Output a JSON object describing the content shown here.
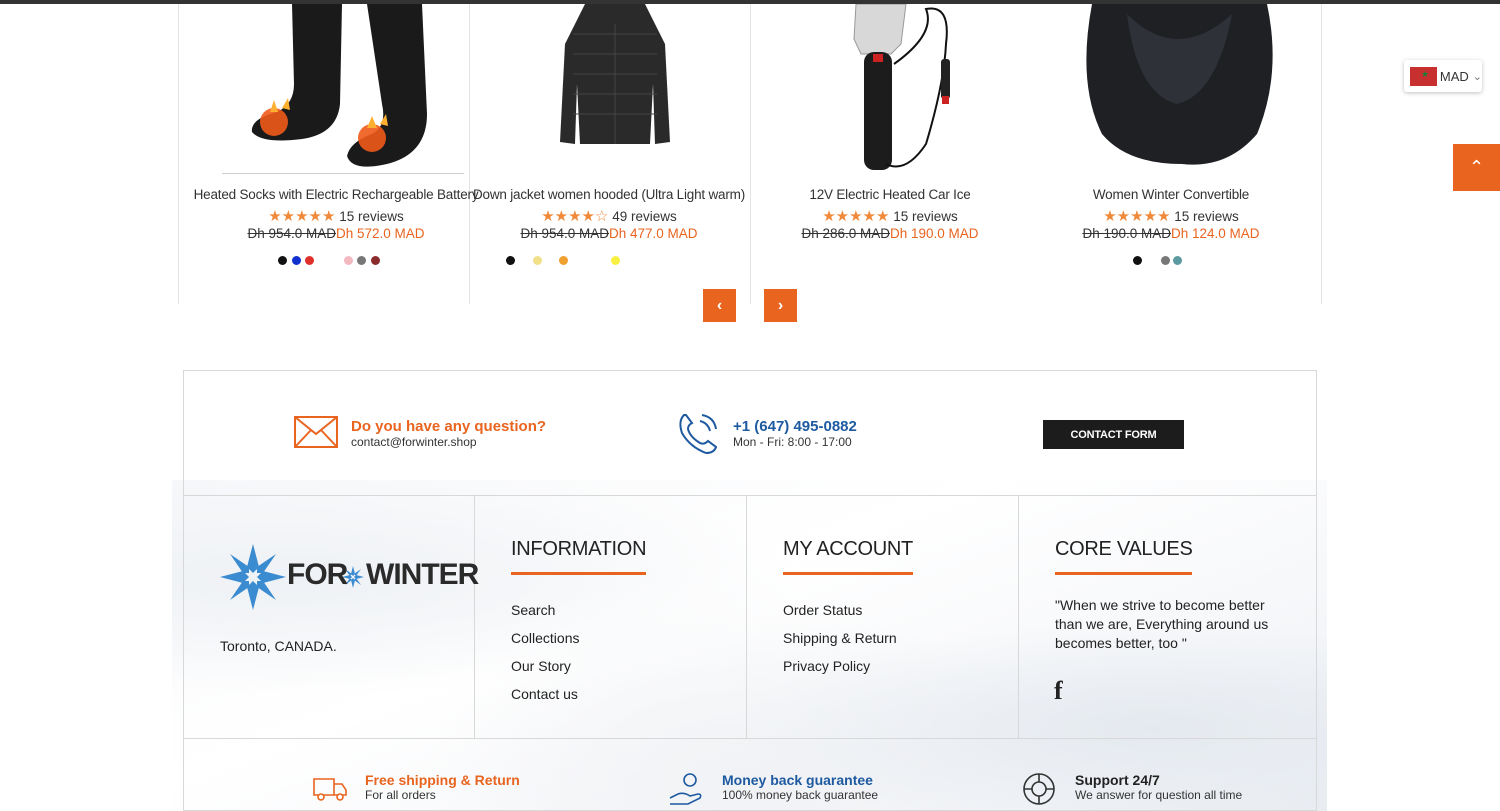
{
  "products": [
    {
      "title": "Heated Socks with Electric Rechargeable Battery",
      "stars": "★★★★★",
      "reviews": "15 reviews",
      "old_price": "Dh 954.0 MAD",
      "new_price": "Dh 572.0 MAD",
      "swatches": [
        "#111111",
        "#1030d0",
        "#e0302a",
        "#f4b8c0",
        "#777777",
        "#8a2c2c"
      ],
      "image": "heated-socks"
    },
    {
      "title": "Down jacket women hooded (Ultra Light warm)",
      "stars": "★★★★☆",
      "reviews": "49 reviews",
      "old_price": "Dh 954.0 MAD",
      "new_price": "Dh 477.0 MAD",
      "swatches": [
        "#111111",
        "#f0e08a",
        "#f0a030",
        "#f8f040"
      ],
      "image": "down-jacket"
    },
    {
      "title": "12V Electric Heated Car Ice",
      "stars": "★★★★★",
      "reviews": "15 reviews",
      "old_price": "Dh 286.0 MAD",
      "new_price": "Dh 190.0 MAD",
      "swatches": [],
      "image": "car-ice-scraper"
    },
    {
      "title": "Women Winter Convertible",
      "stars": "★★★★★",
      "reviews": "15 reviews",
      "old_price": "Dh 190.0 MAD",
      "new_price": "Dh 124.0 MAD",
      "swatches": [
        "#111111",
        "#777777",
        "#5a9aa0"
      ],
      "image": "infinity-scarf"
    }
  ],
  "carousel": {
    "prev_icon": "chevron-left-icon",
    "next_icon": "chevron-right-icon"
  },
  "currency": {
    "code": "MAD"
  },
  "contact": {
    "question_title": "Do you have any question?",
    "email": "contact@forwinter.shop",
    "phone": "+1 (647) 495-0882",
    "hours": "Mon - Fri: 8:00 - 17:00",
    "form_button": "CONTACT FORM"
  },
  "brand": {
    "logo_left": "FOR",
    "logo_right": "WINTER",
    "location": "Toronto, CANADA."
  },
  "information": {
    "title": "INFORMATION",
    "items": [
      "Search",
      "Collections",
      "Our Story",
      "Contact us"
    ]
  },
  "account": {
    "title": "MY ACCOUNT",
    "items": [
      "Order Status",
      "Shipping & Return",
      "Privacy Policy"
    ]
  },
  "core_values": {
    "title": "CORE VALUES",
    "quote": "\"When we strive to become better than we are, Everything around us becomes better, too \""
  },
  "features": [
    {
      "title": "Free shipping & Return",
      "sub": "For all orders"
    },
    {
      "title": "Money back guarantee",
      "sub": "100% money back guarantee"
    },
    {
      "title": "Support 24/7",
      "sub": "We answer for question all time"
    }
  ],
  "colors": {
    "accent": "#e8641f",
    "link_blue": "#1e5aa0",
    "dark": "#1c1c1c"
  }
}
